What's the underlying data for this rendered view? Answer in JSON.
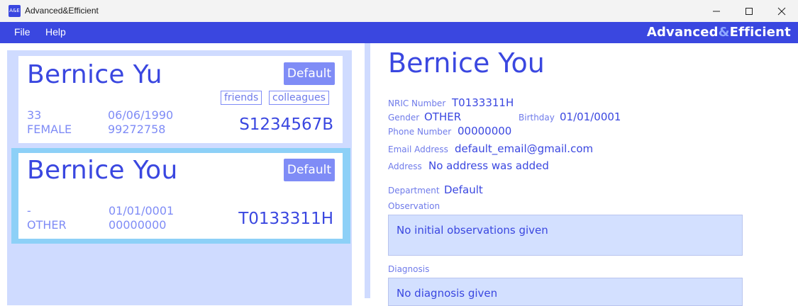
{
  "window": {
    "title": "Advanced&Efficient",
    "icon_text": "A&E"
  },
  "menu": {
    "file": "File",
    "help": "Help",
    "brand_left": "Advanced",
    "brand_amp": "&",
    "brand_right": "Efficient"
  },
  "colors": {
    "accent": "#3a47e0",
    "light_accent": "#7f8cf6",
    "panel_bg": "#cfdbff",
    "selected_border": "#8dd0f7"
  },
  "patients": [
    {
      "name": "Bernice Yu",
      "department": "Default",
      "tags": [
        "friends",
        "colleagues"
      ],
      "age": "33",
      "gender": "FEMALE",
      "birthday": "06/06/1990",
      "phone": "99272758",
      "nric": "S1234567B"
    },
    {
      "name": "Bernice You",
      "department": "Default",
      "tags": [],
      "age": "-",
      "gender": "OTHER",
      "birthday": "01/01/0001",
      "phone": "00000000",
      "nric": "T0133311H"
    }
  ],
  "detail": {
    "name": "Bernice You",
    "nric_label": "NRIC Number",
    "nric": "T0133311H",
    "gender_label": "Gender",
    "gender": "OTHER",
    "birthday_label": "Birthday",
    "birthday": "01/01/0001",
    "phone_label": "Phone Number",
    "phone": "00000000",
    "email_label": "Email Address",
    "email": "default_email@gmail.com",
    "address_label": "Address",
    "address": "No address was added",
    "department_label": "Department",
    "department": "Default",
    "observation_label": "Observation",
    "observation": "No initial observations given",
    "diagnosis_label": "Diagnosis",
    "diagnosis": "No diagnosis given"
  }
}
